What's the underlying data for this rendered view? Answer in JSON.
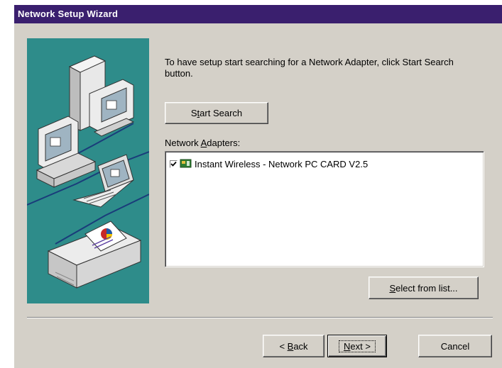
{
  "window": {
    "title": "Network Setup Wizard"
  },
  "wizard": {
    "intro": "To have setup start searching for a Network Adapter, click Start Search button.",
    "start_search": {
      "pre": "S",
      "accel": "t",
      "post": "art Search"
    },
    "adapters_label": {
      "pre": "Network ",
      "accel": "A",
      "post": "dapters:"
    },
    "adapters": [
      {
        "name": "Instant Wireless - Network PC CARD V2.5",
        "checked": true
      }
    ],
    "select_from_list": {
      "pre": "",
      "accel": "S",
      "post": "elect from list..."
    }
  },
  "footer": {
    "back": {
      "pre": "< ",
      "accel": "B",
      "post": "ack"
    },
    "next": {
      "pre": "",
      "accel": "N",
      "post": "ext >"
    },
    "cancel": "Cancel"
  },
  "colors": {
    "titlebar": "#3a1f6e",
    "dialog": "#d4d0c8",
    "illustration": "#2e8c8a"
  }
}
